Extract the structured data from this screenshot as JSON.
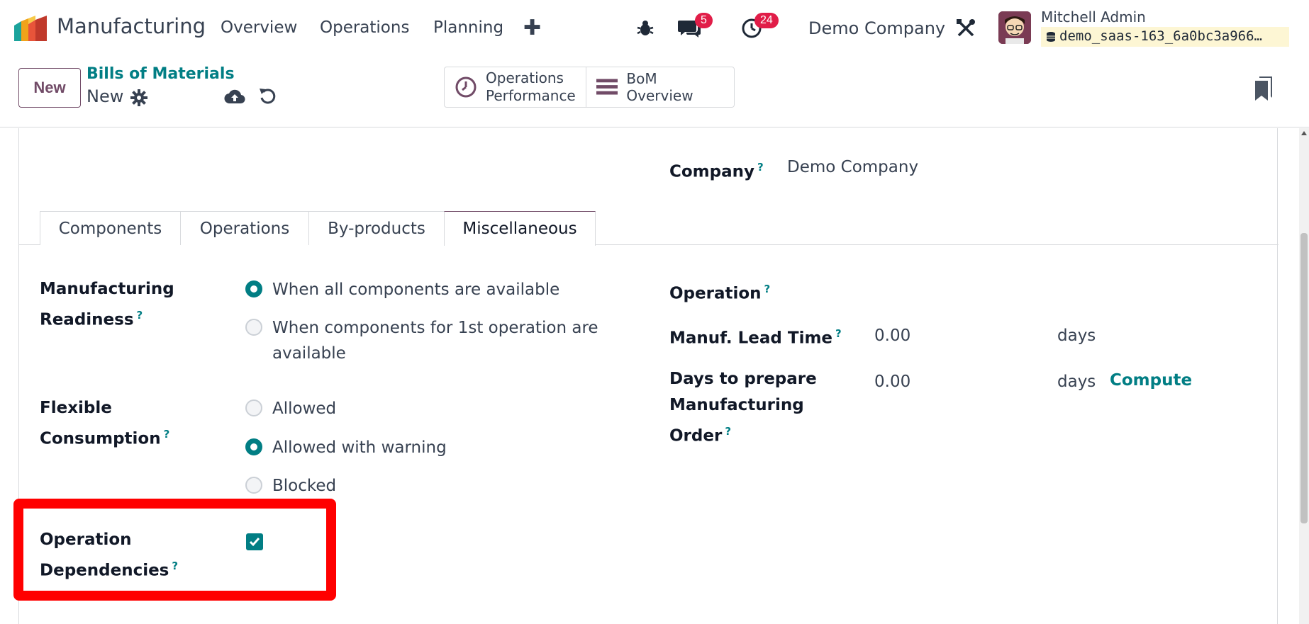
{
  "navbar": {
    "app_name": "Manufacturing",
    "menu": [
      "Overview",
      "Operations",
      "Planning"
    ],
    "messages_count": "5",
    "activities_count": "24",
    "company": "Demo Company",
    "user_name": "Mitchell Admin",
    "database": "demo_saas-163_6a0bc3a966…"
  },
  "control": {
    "new_label": "New",
    "breadcrumb_parent": "Bills of Materials",
    "breadcrumb_current": "New",
    "smart_buttons": {
      "ops_perf_line1": "Operations",
      "ops_perf_line2": "Performance",
      "bom_overview": "BoM Overview"
    }
  },
  "form": {
    "company_label": "Company",
    "company_value": "Demo Company",
    "tabs": [
      "Components",
      "Operations",
      "By-products",
      "Miscellaneous"
    ],
    "active_tab": "Miscellaneous",
    "readiness_label_1": "Manufacturing",
    "readiness_label_2": "Readiness",
    "readiness_options": [
      "When all components are available",
      "When components for 1st operation are",
      "available"
    ],
    "flexible_label_1": "Flexible",
    "flexible_label_2": "Consumption",
    "flexible_options": [
      "Allowed",
      "Allowed with warning",
      "Blocked"
    ],
    "dependencies_label_1": "Operation",
    "dependencies_label_2": "Dependencies",
    "dependencies_checked": true,
    "operation_label": "Operation",
    "lead_time_label": "Manuf. Lead Time",
    "lead_time_value": "0.00",
    "lead_time_unit": "days",
    "prepare_label_1": "Days to prepare",
    "prepare_label_2": "Manufacturing",
    "prepare_label_3": "Order",
    "prepare_value": "0.00",
    "prepare_unit": "days",
    "compute_label": "Compute",
    "help_mark": "?"
  },
  "colors": {
    "brand": "#714b67",
    "accent": "#017e84",
    "badge": "#e11d48",
    "highlight": "#ff0000"
  }
}
